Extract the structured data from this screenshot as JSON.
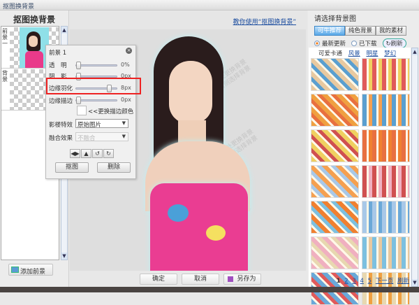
{
  "window": {
    "title": "抠图换背景"
  },
  "left": {
    "heading": "抠图换背景",
    "layers": [
      {
        "label": "前景一"
      },
      {
        "label": "背景"
      }
    ],
    "add_button": "添加前景"
  },
  "center": {
    "help_link": "教你使用“抠图换背景”",
    "watermark": "双击此处更换背景\n或在右侧选择背景",
    "buttons": {
      "ok": "确定",
      "cancel": "取消",
      "save_as": "另存为"
    }
  },
  "panel": {
    "title": "前景 1",
    "sliders": [
      {
        "label": "透　明",
        "value": "0%",
        "level": 0
      },
      {
        "label": "阴　影",
        "value": "0px",
        "level": 0
      },
      {
        "label": "边缘羽化",
        "value": "8px",
        "level": 0.8
      },
      {
        "label": "边缘描边",
        "value": "0px",
        "level": 0
      }
    ],
    "stroke_color_label": "<<更换描边颜色",
    "effect_label": "影楼特效",
    "effect_value": "原始图片",
    "blend_label": "融合效果",
    "blend_value": "不融合",
    "cutout_button": "抠图",
    "delete_button": "删除"
  },
  "right": {
    "heading": "请选择背景图",
    "tabs": [
      "可牛推荐",
      "纯色背景",
      "我的素材"
    ],
    "radios": {
      "latest": "最新更新",
      "downloaded": "已下载",
      "refresh": "刷新"
    },
    "categories": {
      "current": "可爱卡通",
      "links": [
        "风景",
        "明星",
        "梦幻"
      ]
    },
    "tiles": [
      "#e8c9a0",
      "#e05a5a",
      "#f0a040",
      "#5a9fd0",
      "#f0d060",
      "#e87040",
      "#f5a050",
      "#d05050",
      "#f08030",
      "#a8c8e8",
      "#f0b0c0",
      "#7cc0e0",
      "#6aa8d8",
      "#e8d8b0"
    ],
    "pager": {
      "current": "1",
      "pages": [
        "2",
        "3",
        "4",
        "5"
      ],
      "next": "下一页",
      "refresh": "刷新"
    }
  }
}
